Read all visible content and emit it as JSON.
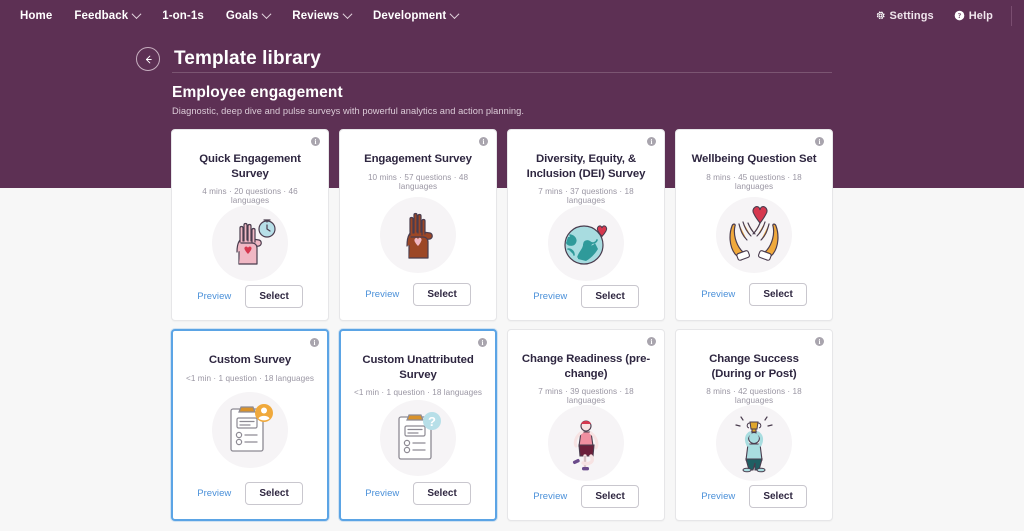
{
  "nav": {
    "items": [
      {
        "label": "Home",
        "caret": false
      },
      {
        "label": "Feedback",
        "caret": true
      },
      {
        "label": "1-on-1s",
        "caret": false
      },
      {
        "label": "Goals",
        "caret": true
      },
      {
        "label": "Reviews",
        "caret": true
      },
      {
        "label": "Development",
        "caret": true
      }
    ],
    "settings_label": "Settings",
    "settings_icon": "gear-icon",
    "help_label": "Help",
    "help_icon": "question-circle-icon"
  },
  "header": {
    "back_icon": "arrow-left-icon",
    "title": "Template library"
  },
  "section": {
    "title": "Employee engagement",
    "subtitle": "Diagnostic, deep dive and pulse surveys with powerful analytics and action planning."
  },
  "buttons": {
    "preview_label": "Preview",
    "select_label": "Select",
    "info_label": "i"
  },
  "colors": {
    "brand_purple": "#5d3054",
    "selected_border": "#5ba4e5",
    "link_blue": "#4a90d9",
    "page_background": "#f7f7f7",
    "card_background": "#ffffff"
  },
  "cards": [
    {
      "title": "Quick Engagement Survey",
      "meta": "4 mins · 20 questions · 46 languages",
      "art": "hand-heart-stopwatch-illustration",
      "selected": false
    },
    {
      "title": "Engagement Survey",
      "meta": "10 mins · 57 questions · 48 languages",
      "art": "brown-hand-heart-illustration",
      "selected": false
    },
    {
      "title": "Diversity, Equity, & Inclusion (DEI) Survey",
      "meta": "7 mins · 37 questions · 18 languages",
      "art": "globe-heart-illustration",
      "selected": false
    },
    {
      "title": "Wellbeing Question Set",
      "meta": "8 mins · 45 questions · 18 languages",
      "art": "cupped-hands-heart-illustration",
      "selected": false
    },
    {
      "title": "Custom Survey",
      "meta": "<1 min · 1 question · 18 languages",
      "art": "clipboard-person-illustration",
      "selected": true
    },
    {
      "title": "Custom Unattributed Survey",
      "meta": "<1 min · 1 question · 18 languages",
      "art": "clipboard-question-illustration",
      "selected": true
    },
    {
      "title": "Change Readiness (pre-change)",
      "meta": "7 mins · 39 questions · 18 languages",
      "art": "person-stretching-illustration",
      "selected": false
    },
    {
      "title": "Change Success (During or Post)",
      "meta": "8 mins · 42 questions · 18 languages",
      "art": "person-trophy-illustration",
      "selected": false
    }
  ]
}
